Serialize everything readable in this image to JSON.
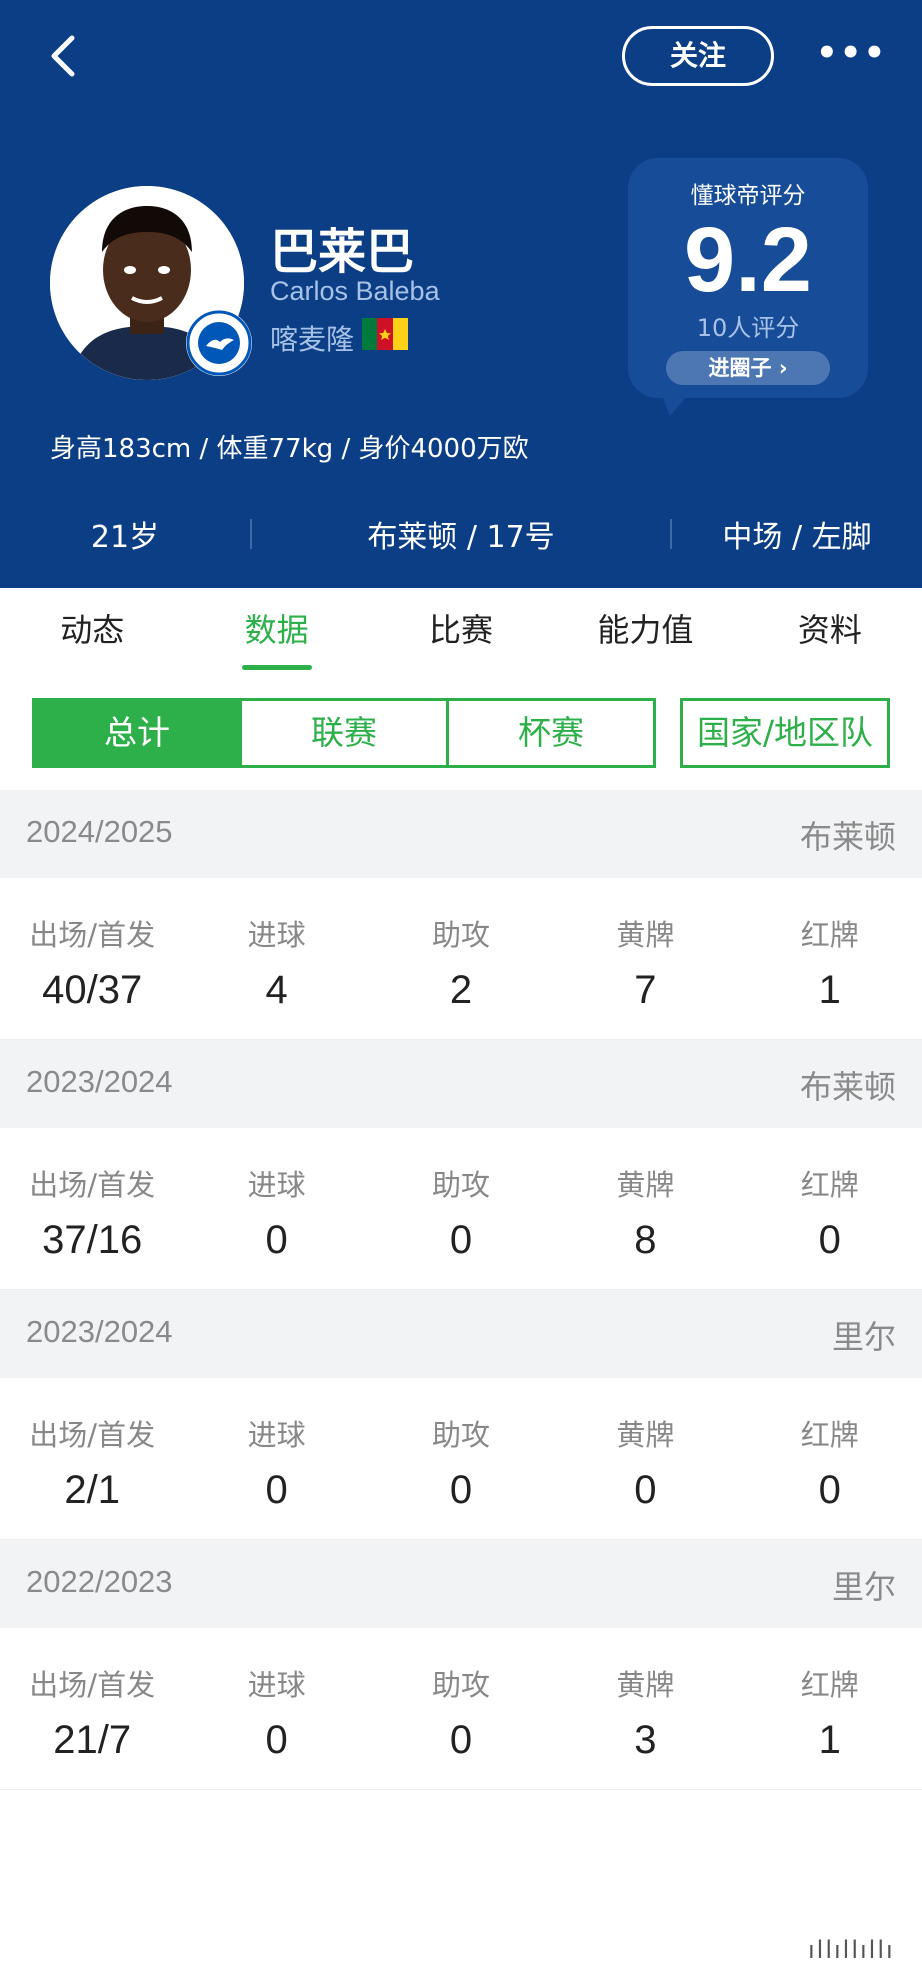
{
  "header": {
    "follow_label": "关注",
    "more_label": "•••",
    "player": {
      "name_cn": "巴莱巴",
      "name_en": "Carlos Baleba",
      "nationality": "喀麦隆",
      "physical": "身高183cm / 体重77kg / 身价4000万欧"
    },
    "rating": {
      "title": "懂球帝评分",
      "score": "9.2",
      "count": "10人评分",
      "button": "进圈子 ›"
    },
    "info": {
      "age": "21岁",
      "club": "布莱顿 / 17号",
      "position": "中场 / 左脚"
    },
    "colors": {
      "bg": "#0c3e86",
      "flag": [
        "#007a3d",
        "#ce1126",
        "#fcd116"
      ]
    }
  },
  "tabs": [
    {
      "label": "动态"
    },
    {
      "label": "数据",
      "active": true
    },
    {
      "label": "比赛"
    },
    {
      "label": "能力值"
    },
    {
      "label": "资料"
    }
  ],
  "filter": {
    "items": [
      "总计",
      "联赛",
      "杯赛",
      "国家/地区队"
    ],
    "active": 0,
    "accent": "#2db04a"
  },
  "stat_labels": [
    "出场/首发",
    "进球",
    "助攻",
    "黄牌",
    "红牌"
  ],
  "seasons": [
    {
      "year": "2024/2025",
      "team": "布莱顿",
      "values": [
        "40/37",
        "4",
        "2",
        "7",
        "1"
      ]
    },
    {
      "year": "2023/2024",
      "team": "布莱顿",
      "values": [
        "37/16",
        "0",
        "0",
        "8",
        "0"
      ]
    },
    {
      "year": "2023/2024",
      "team": "里尔",
      "values": [
        "2/1",
        "0",
        "0",
        "0",
        "0"
      ]
    },
    {
      "year": "2022/2023",
      "team": "里尔",
      "values": [
        "21/7",
        "0",
        "0",
        "3",
        "1"
      ]
    }
  ],
  "home_indicator": "ıllıllıllı"
}
